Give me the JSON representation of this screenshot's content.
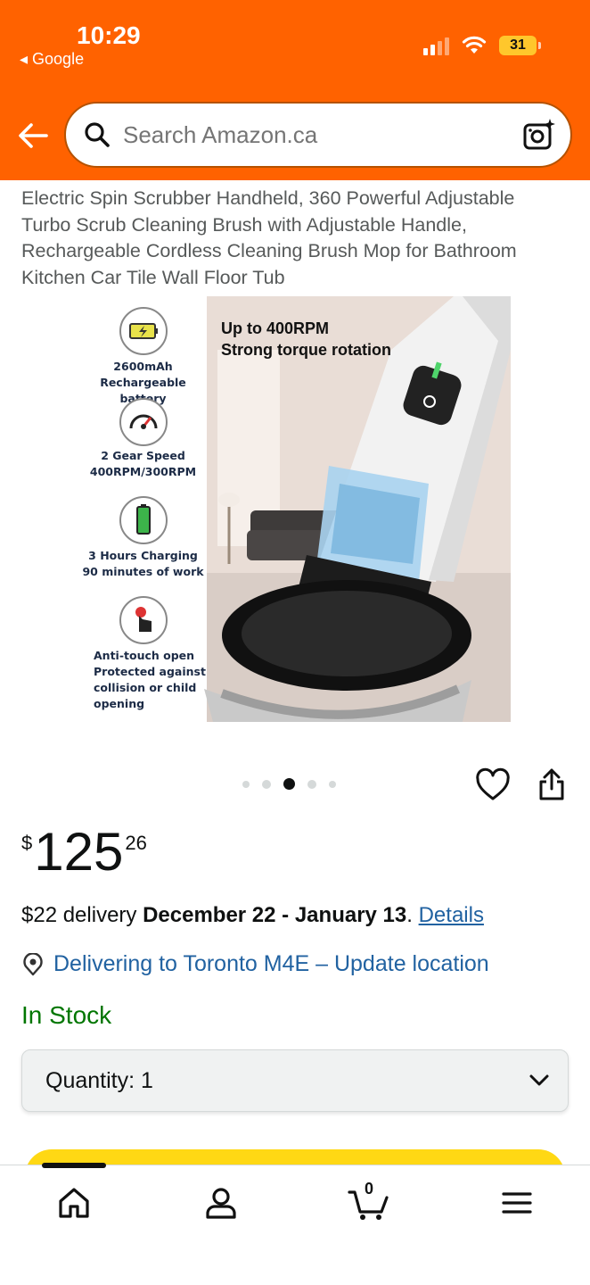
{
  "status_bar": {
    "time": "10:29",
    "back_app": "◂ Google",
    "battery": "31"
  },
  "search": {
    "placeholder": "Search Amazon.ca"
  },
  "product": {
    "title": "Electric Spin Scrubber Handheld, 360 Powerful Adjustable Turbo Scrub Cleaning Brush with Adjustable Handle, Rechargeable Cordless Cleaning Brush Mop for Bathroom Kitchen Car Tile Wall Floor Tub",
    "image_text": {
      "headline_1": "Up to 400RPM",
      "headline_2": "Strong torque rotation",
      "features": [
        {
          "line1": "2600mAh",
          "line2": "Rechargeable battery",
          "icon": "battery-icon"
        },
        {
          "line1": "2 Gear Speed",
          "line2": "400RPM/300RPM",
          "icon": "speedometer-icon"
        },
        {
          "line1": "3 Hours Charging",
          "line2": "90 minutes of work",
          "icon": "charging-icon"
        },
        {
          "line1": "Anti-touch open",
          "line2": "Protected against",
          "line3": "collision or child",
          "line4": "opening",
          "icon": "touch-icon"
        }
      ]
    },
    "carousel": {
      "count": 5,
      "active_index": 2
    },
    "price": {
      "currency": "$",
      "whole": "125",
      "fraction": "26"
    },
    "delivery": {
      "prefix": "$22 delivery ",
      "dates": "December 22 - January 13",
      "suffix": ". ",
      "details_link": "Details"
    },
    "location": "Delivering to Toronto M4E – Update location",
    "stock": "In Stock",
    "quantity_label": "Quantity:  1"
  },
  "bottom_nav": {
    "cart_count": "0",
    "items": [
      "home-icon",
      "account-icon",
      "cart-icon",
      "menu-icon"
    ]
  },
  "colors": {
    "header": "#ff6200",
    "link": "#2162a1",
    "in_stock": "#007600",
    "buy_button": "#ffd814"
  }
}
